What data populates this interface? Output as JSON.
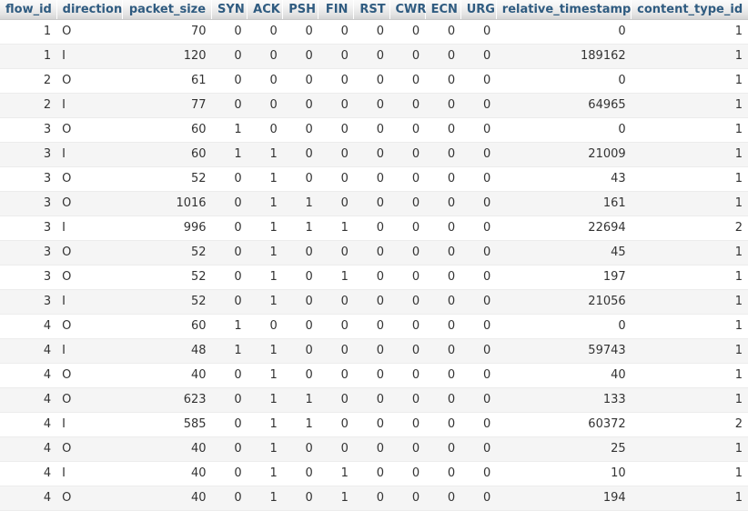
{
  "table": {
    "columns": [
      {
        "key": "flow_id",
        "label": "flow_id",
        "align": "num",
        "cls": "c-flow"
      },
      {
        "key": "direction",
        "label": "direction",
        "align": "txt",
        "cls": "c-dir"
      },
      {
        "key": "packet_size",
        "label": "packet_size",
        "align": "num",
        "cls": "c-psize"
      },
      {
        "key": "SYN",
        "label": "SYN",
        "align": "num",
        "cls": "c-flag"
      },
      {
        "key": "ACK",
        "label": "ACK",
        "align": "num",
        "cls": "c-flag"
      },
      {
        "key": "PSH",
        "label": "PSH",
        "align": "num",
        "cls": "c-flag"
      },
      {
        "key": "FIN",
        "label": "FIN",
        "align": "num",
        "cls": "c-flag"
      },
      {
        "key": "RST",
        "label": "RST",
        "align": "num",
        "cls": "c-flag"
      },
      {
        "key": "CWR",
        "label": "CWR",
        "align": "num",
        "cls": "c-flag"
      },
      {
        "key": "ECN",
        "label": "ECN",
        "align": "num",
        "cls": "c-flag"
      },
      {
        "key": "URG",
        "label": "URG",
        "align": "num",
        "cls": "c-flag"
      },
      {
        "key": "relative_timestamp",
        "label": "relative_timestamp",
        "align": "num",
        "cls": "c-rts"
      },
      {
        "key": "content_type_id",
        "label": "content_type_id",
        "align": "num",
        "cls": "c-ctid"
      }
    ],
    "rows": [
      [
        "1",
        "O",
        "70",
        "0",
        "0",
        "0",
        "0",
        "0",
        "0",
        "0",
        "0",
        "0",
        "1"
      ],
      [
        "1",
        "I",
        "120",
        "0",
        "0",
        "0",
        "0",
        "0",
        "0",
        "0",
        "0",
        "189162",
        "1"
      ],
      [
        "2",
        "O",
        "61",
        "0",
        "0",
        "0",
        "0",
        "0",
        "0",
        "0",
        "0",
        "0",
        "1"
      ],
      [
        "2",
        "I",
        "77",
        "0",
        "0",
        "0",
        "0",
        "0",
        "0",
        "0",
        "0",
        "64965",
        "1"
      ],
      [
        "3",
        "O",
        "60",
        "1",
        "0",
        "0",
        "0",
        "0",
        "0",
        "0",
        "0",
        "0",
        "1"
      ],
      [
        "3",
        "I",
        "60",
        "1",
        "1",
        "0",
        "0",
        "0",
        "0",
        "0",
        "0",
        "21009",
        "1"
      ],
      [
        "3",
        "O",
        "52",
        "0",
        "1",
        "0",
        "0",
        "0",
        "0",
        "0",
        "0",
        "43",
        "1"
      ],
      [
        "3",
        "O",
        "1016",
        "0",
        "1",
        "1",
        "0",
        "0",
        "0",
        "0",
        "0",
        "161",
        "1"
      ],
      [
        "3",
        "I",
        "996",
        "0",
        "1",
        "1",
        "1",
        "0",
        "0",
        "0",
        "0",
        "22694",
        "2"
      ],
      [
        "3",
        "O",
        "52",
        "0",
        "1",
        "0",
        "0",
        "0",
        "0",
        "0",
        "0",
        "45",
        "1"
      ],
      [
        "3",
        "O",
        "52",
        "0",
        "1",
        "0",
        "1",
        "0",
        "0",
        "0",
        "0",
        "197",
        "1"
      ],
      [
        "3",
        "I",
        "52",
        "0",
        "1",
        "0",
        "0",
        "0",
        "0",
        "0",
        "0",
        "21056",
        "1"
      ],
      [
        "4",
        "O",
        "60",
        "1",
        "0",
        "0",
        "0",
        "0",
        "0",
        "0",
        "0",
        "0",
        "1"
      ],
      [
        "4",
        "I",
        "48",
        "1",
        "1",
        "0",
        "0",
        "0",
        "0",
        "0",
        "0",
        "59743",
        "1"
      ],
      [
        "4",
        "O",
        "40",
        "0",
        "1",
        "0",
        "0",
        "0",
        "0",
        "0",
        "0",
        "40",
        "1"
      ],
      [
        "4",
        "O",
        "623",
        "0",
        "1",
        "1",
        "0",
        "0",
        "0",
        "0",
        "0",
        "133",
        "1"
      ],
      [
        "4",
        "I",
        "585",
        "0",
        "1",
        "1",
        "0",
        "0",
        "0",
        "0",
        "0",
        "60372",
        "2"
      ],
      [
        "4",
        "O",
        "40",
        "0",
        "1",
        "0",
        "0",
        "0",
        "0",
        "0",
        "0",
        "25",
        "1"
      ],
      [
        "4",
        "I",
        "40",
        "0",
        "1",
        "0",
        "1",
        "0",
        "0",
        "0",
        "0",
        "10",
        "1"
      ],
      [
        "4",
        "O",
        "40",
        "0",
        "1",
        "0",
        "1",
        "0",
        "0",
        "0",
        "0",
        "194",
        "1"
      ]
    ]
  },
  "colors": {
    "header_text": "#2f5b80",
    "header_bg_top": "#fbfbfb",
    "header_bg_bottom": "#d3d3d3",
    "row_odd_bg": "#ffffff",
    "row_even_bg": "#f5f5f5",
    "cell_text": "#333333",
    "row_divider": "#ececec"
  }
}
